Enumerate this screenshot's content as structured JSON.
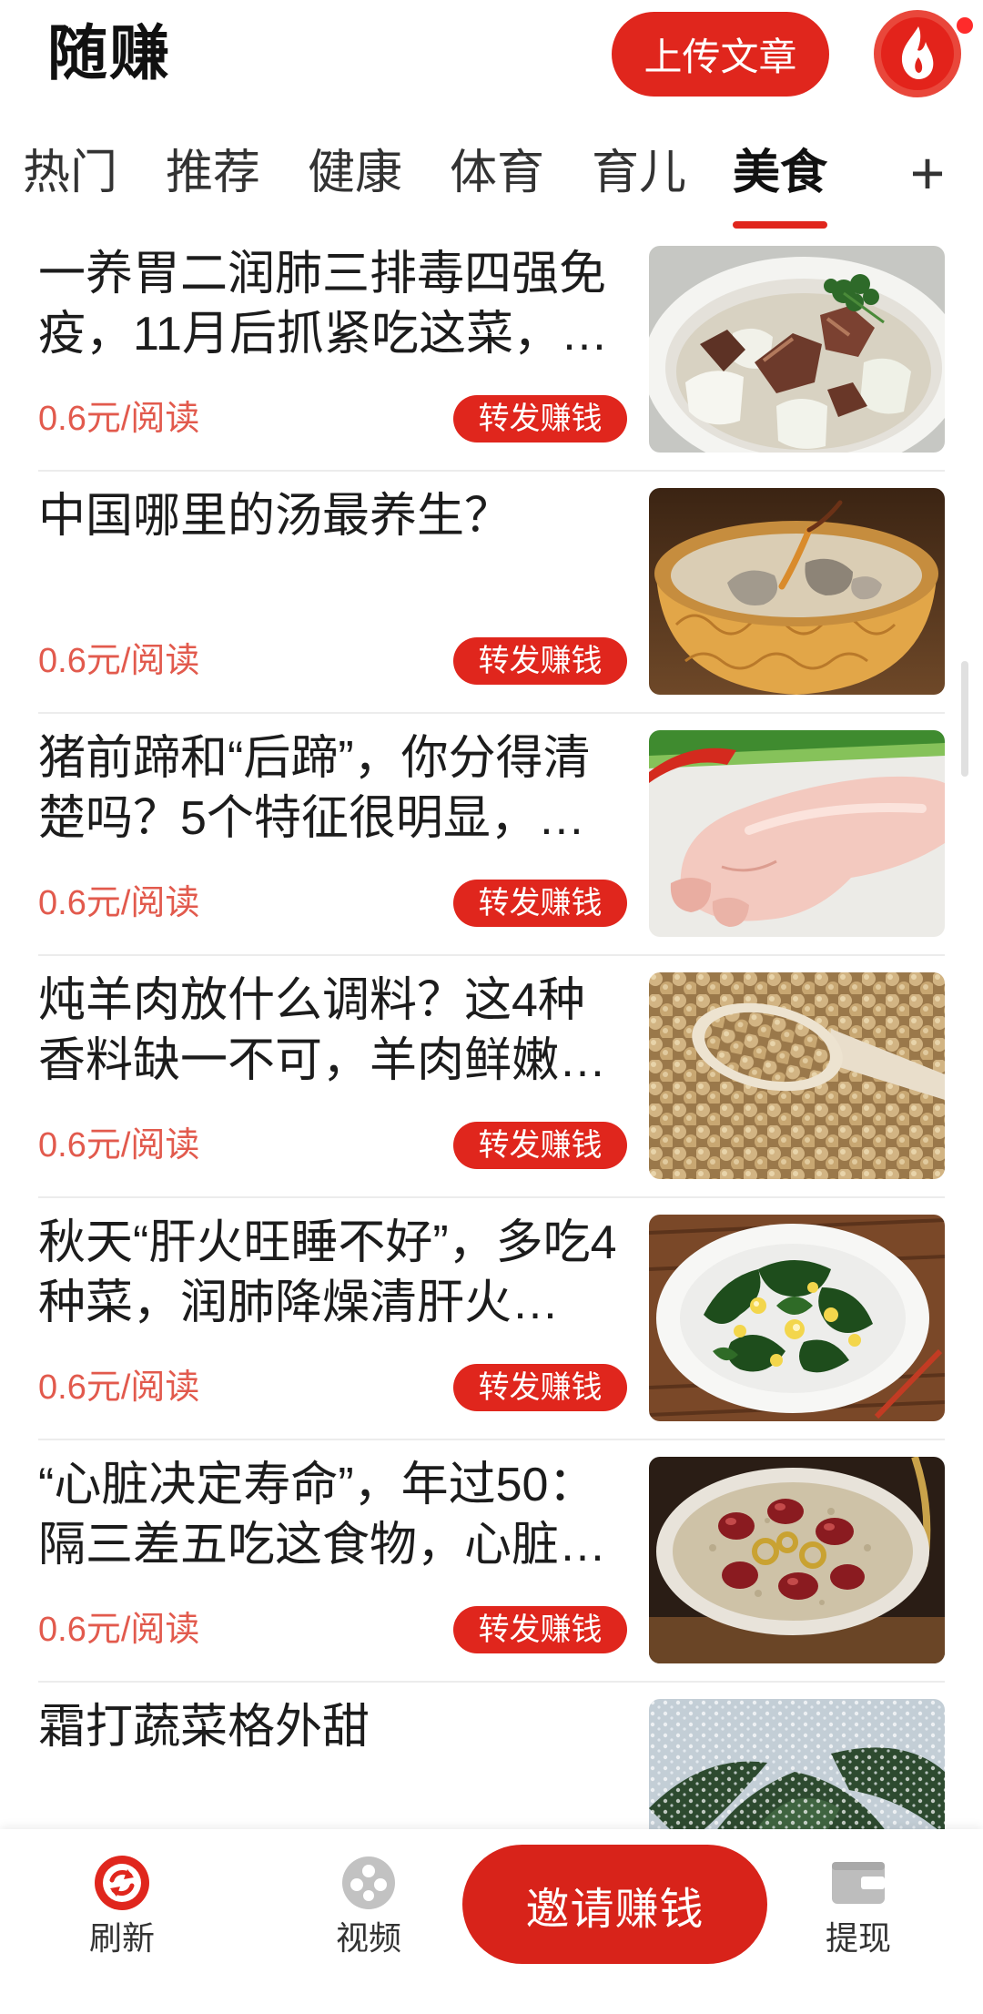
{
  "colors": {
    "accent": "#e0261d",
    "accent_dark": "#d8231a",
    "price": "#e25a4d",
    "text": "#1c1c1c"
  },
  "header": {
    "title": "随赚",
    "upload_button": "上传文章",
    "avatar_icon": "flame-icon"
  },
  "tabs": {
    "items": [
      {
        "label": "热门"
      },
      {
        "label": "推荐"
      },
      {
        "label": "健康"
      },
      {
        "label": "体育"
      },
      {
        "label": "育儿"
      },
      {
        "label": "美食"
      }
    ],
    "active_index": 5,
    "add_label": "+"
  },
  "feed": [
    {
      "title": "一养胃二润肺三排毒四强免疫，11月后抓紧吃这菜，…",
      "price": "0.6元/阅读",
      "share_button": "转发赚钱"
    },
    {
      "title": "中国哪里的汤最养生？",
      "price": "0.6元/阅读",
      "share_button": "转发赚钱"
    },
    {
      "title": "猪前蹄和“后蹄”，你分得清楚吗？5个特征很明显，…",
      "price": "0.6元/阅读",
      "share_button": "转发赚钱"
    },
    {
      "title": "炖羊肉放什么调料？这4种香料缺一不可，羊肉鲜嫩…",
      "price": "0.6元/阅读",
      "share_button": "转发赚钱"
    },
    {
      "title": "秋天“肝火旺睡不好”，多吃4种菜，润肺降燥清肝火…",
      "price": "0.6元/阅读",
      "share_button": "转发赚钱"
    },
    {
      "title": "“心脏决定寿命”，年过50：隔三差五吃这食物，心脏…",
      "price": "0.6元/阅读",
      "share_button": "转发赚钱"
    },
    {
      "title": "霜打蔬菜格外甜"
    }
  ],
  "bottom_nav": {
    "refresh": {
      "label": "刷新",
      "icon": "refresh-icon"
    },
    "video": {
      "label": "视频",
      "icon": "video-reel-icon"
    },
    "invite_button": "邀请赚钱",
    "withdraw": {
      "label": "提现",
      "icon": "wallet-icon"
    }
  }
}
